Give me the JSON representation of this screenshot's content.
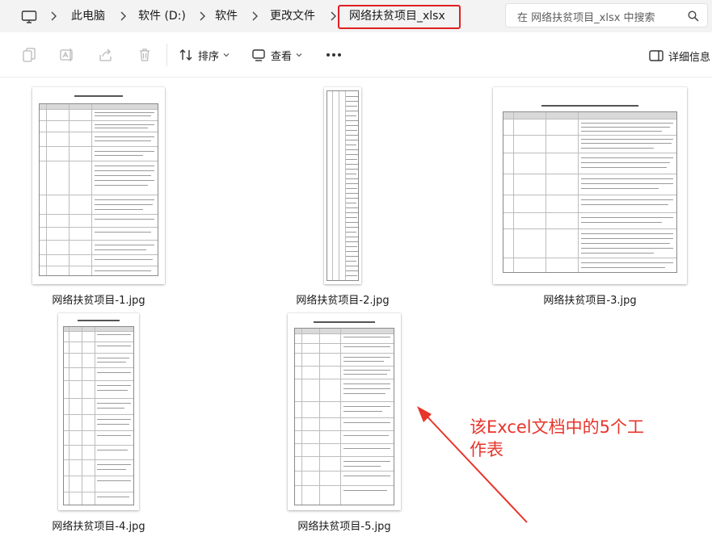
{
  "address": {
    "crumbs": [
      "此电脑",
      "软件 (D:)",
      "软件",
      "更改文件",
      "网络扶贫项目_xlsx"
    ],
    "current_highlight_color": "#e02020"
  },
  "search": {
    "placeholder": "在 网络扶贫项目_xlsx 中搜索"
  },
  "toolbar": {
    "sort_label": "排序",
    "view_label": "查看",
    "details_label": "详细信息",
    "icons": [
      "copy-icon",
      "rename-icon",
      "share-icon",
      "delete-icon",
      "sort-icon",
      "view-icon",
      "more-icon",
      "details-pane-icon"
    ]
  },
  "files": [
    {
      "name": "网络扶贫项目-1.jpg"
    },
    {
      "name": "网络扶贫项目-2.jpg"
    },
    {
      "name": "网络扶贫项目-3.jpg"
    },
    {
      "name": "网络扶贫项目-4.jpg"
    },
    {
      "name": "网络扶贫项目-5.jpg"
    }
  ],
  "annotation": {
    "line1": "该Excel文档中的5个工",
    "line2": "作表",
    "color": "#e8352b"
  }
}
